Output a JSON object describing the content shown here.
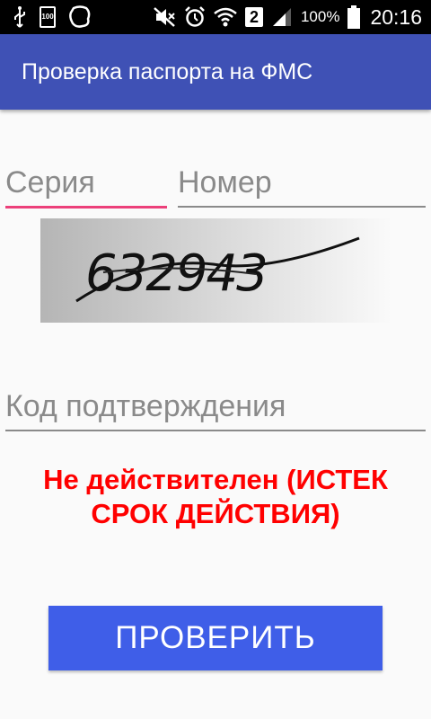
{
  "status_bar": {
    "battery_small_label": "100",
    "sim_label": "2",
    "battery_percent": "100%",
    "time": "20:16"
  },
  "app_bar": {
    "title": "Проверка паспорта на ФМС"
  },
  "form": {
    "series_placeholder": "Серия",
    "number_placeholder": "Номер",
    "captcha_text": "632943",
    "code_placeholder": "Код подтверждения"
  },
  "result": {
    "line1": "Не действителен (ИСТЕК",
    "line2": "СРОК ДЕЙСТВИЯ)",
    "color": "#ff0000"
  },
  "button": {
    "label": "ПРОВЕРИТЬ"
  },
  "colors": {
    "accent": "#3f51b5",
    "focus": "#ec407a",
    "button": "#3f5ee8"
  }
}
